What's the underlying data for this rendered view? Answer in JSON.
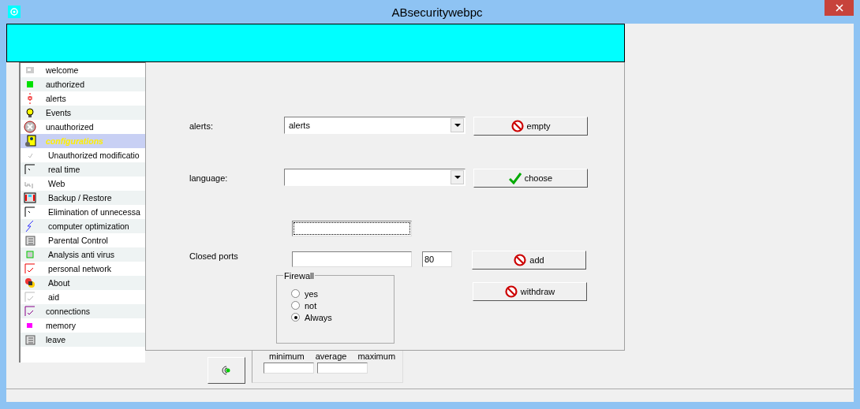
{
  "window": {
    "title": "ABsecuritywebpc"
  },
  "sidebar": {
    "items": [
      {
        "label": "welcome",
        "selected": false
      },
      {
        "label": "authorized",
        "selected": false
      },
      {
        "label": "alerts",
        "selected": false
      },
      {
        "label": "Events",
        "selected": false
      },
      {
        "label": "unauthorized",
        "selected": false
      },
      {
        "label": "configurations",
        "selected": true,
        "children": [
          {
            "label": "Unauthorized modificatio",
            "selected": false
          },
          {
            "label": "real time",
            "selected": false
          },
          {
            "label": "Web",
            "selected": false
          },
          {
            "label": "Backup / Restore",
            "selected": false
          },
          {
            "label": "Elimination of unnecessa",
            "selected": false
          },
          {
            "label": "computer optimization",
            "selected": false
          },
          {
            "label": "Parental Control",
            "selected": false
          },
          {
            "label": "Analysis anti virus",
            "selected": false
          },
          {
            "label": "personal network",
            "selected": false
          },
          {
            "label": "About",
            "selected": false
          },
          {
            "label": "aid",
            "selected": false
          }
        ]
      },
      {
        "label": "connections",
        "selected": false
      },
      {
        "label": "memory",
        "selected": false
      },
      {
        "label": "leave",
        "selected": false
      }
    ]
  },
  "form": {
    "alerts_label": "alerts:",
    "alerts_value": "alerts",
    "empty_button": "empty",
    "language_label": "language:",
    "choose_button": "choose",
    "closed_ports_label": "Closed ports",
    "port_value": "80",
    "add_button": "add",
    "withdraw_button": "withdraw",
    "firewall": {
      "title": "Firewall",
      "options": [
        {
          "label": "yes",
          "selected": false
        },
        {
          "label": "not",
          "selected": false
        },
        {
          "label": "Always",
          "selected": true
        }
      ]
    }
  },
  "stats": {
    "labels": [
      "minimum",
      "average",
      "maximum"
    ]
  }
}
